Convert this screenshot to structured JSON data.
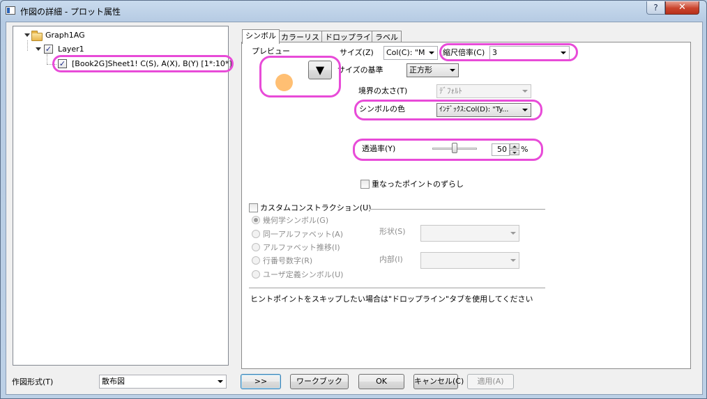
{
  "window": {
    "title": "作図の詳細 - プロット属性",
    "help_label": "?",
    "close_label": "✕"
  },
  "tree": {
    "root_label": "Graph1AG",
    "layer_label": "Layer1",
    "plot_label": "[Book2G]Sheet1! C(S), A(X), B(Y) [1*:10*]",
    "check_mark": "✓"
  },
  "tabs": [
    "シンボル",
    "カラーリスト",
    "ドロップライン",
    "ラベル"
  ],
  "symbol": {
    "preview_label": "プレビュー",
    "preview_color": "#ffbf73",
    "size_label": "サイズ(Z)",
    "size_value": "Col(C): \"M",
    "scale_label": "縮尺倍率(C)",
    "scale_value": "3",
    "size_basis_label": "サイズの基準",
    "size_basis_value": "正方形",
    "edge_width_label": "境界の太さ(T)",
    "edge_width_value": "ﾃﾞﾌｫﾙﾄ",
    "color_label": "シンボルの色",
    "color_value": "ｲﾝﾃﾞｯｸｽ:Col(D): \"Ty...",
    "transparency_label": "透過率(Y)",
    "transparency_value": "50",
    "transparency_level": 0.5,
    "percent_label": "%",
    "offset_label": "重なったポイントのずらし",
    "custom_label": "カスタムコンストラクション(U)",
    "radio_options": [
      "幾何学シンボル(G)",
      "同一アルファベット(A)",
      "アルファベット推移(I)",
      "行番号数字(R)",
      "ユーザ定義シンボル(U)"
    ],
    "shape_label": "形状(S)",
    "interior_label": "内部(I)",
    "hint": "ヒントポイントをスキップしたい場合は\"ドロップライン\"タブを使用してください"
  },
  "footer": {
    "plot_type_label": "作図形式(T)",
    "plot_type_value": "散布図",
    "more_button": ">>",
    "workbook_button": "ワークブック",
    "ok_button": "OK",
    "cancel_button": "キャンセル(C)",
    "apply_button": "適用(A)"
  },
  "colors": {
    "highlight": "#e84bd8",
    "window_frame": "#bcd0e6"
  }
}
